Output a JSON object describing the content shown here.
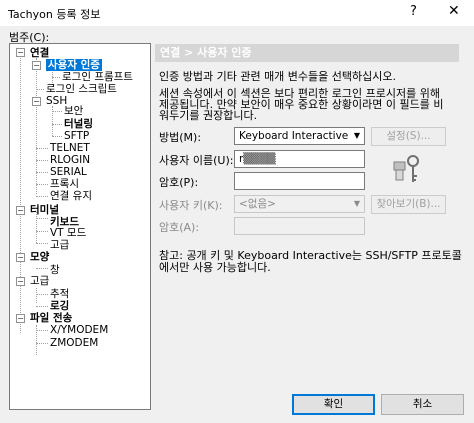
{
  "window": {
    "title": "Tachyon 등록 정보",
    "help": "?",
    "close": "✕"
  },
  "tree": {
    "label": "범주(C):",
    "nodes": {
      "conn": "연결",
      "auth": "사용자 인증",
      "login_prompt": "로그인 프롬프트",
      "login_script": "로그인 스크립트",
      "ssh": "SSH",
      "security": "보안",
      "tunneling": "터널링",
      "sftp": "SFTP",
      "telnet": "TELNET",
      "rlogin": "RLOGIN",
      "serial": "SERIAL",
      "proxy": "프록시",
      "keepalive": "연결 유지",
      "terminal": "터미널",
      "keyboard": "키보드",
      "vt": "VT 모드",
      "advanced": "고급",
      "appearance": "모양",
      "window": "창",
      "adv": "고급",
      "trace": "추적",
      "logging": "로깅",
      "filetransfer": "파일 전송",
      "xymodem": "X/YMODEM",
      "zmodem": "ZMODEM"
    }
  },
  "panel": {
    "breadcrumb": "연결 > 사용자 인증",
    "intro": "인증 방법과 기타 관련 매개 변수들을 선택하십시오.",
    "warning_line1": "세션 속성에서 이 섹션은 보다 편리한 로그인 프로시저를 위해",
    "warning_line2": "제공됩니다. 만약 보안이 매우 중요한 상황이라면 이 필드를 비",
    "warning_line3": "워두기를 권장합니다.",
    "method_label": "방법(M):",
    "method_value": "Keyboard Interactive",
    "settings_button": "설정(S)...",
    "username_label": "사용자 이름(U):",
    "username_value": "r▒▒▒▒",
    "password_label": "암호(P):",
    "password_value": "",
    "userkey_label": "사용자 키(K):",
    "userkey_value": "<없음>",
    "browse_button": "찾아보기(B)...",
    "passphrase_label": "암호(A):",
    "passphrase_value": "",
    "note_line1": "참고: 공개 키 및 Keyboard Interactive는 SSH/SFTP 프로토콜",
    "note_line2": "에서만 사용 가능합니다."
  },
  "buttons": {
    "ok": "확인",
    "cancel": "취소"
  }
}
